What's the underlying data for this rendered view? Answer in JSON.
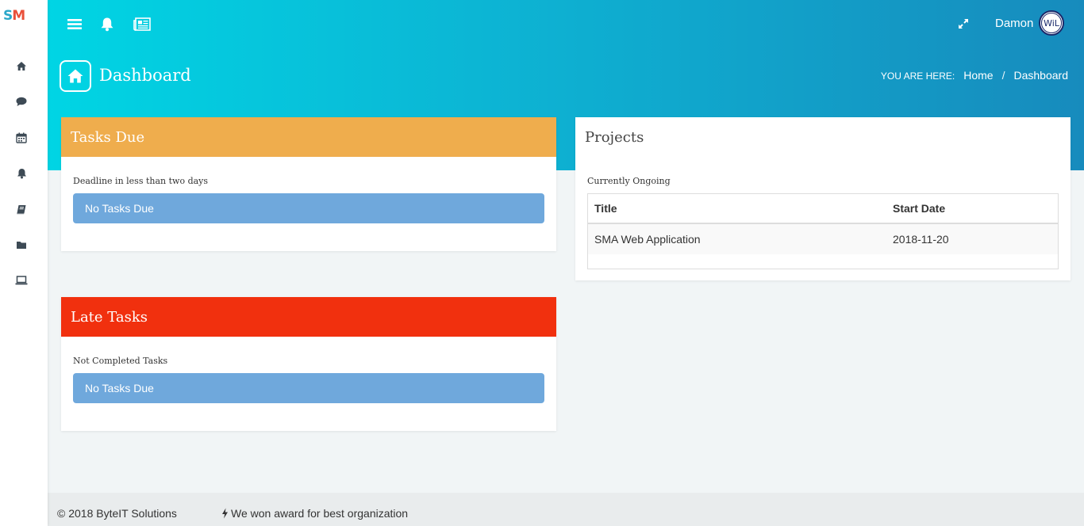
{
  "logo": {
    "s": "S",
    "m": "M"
  },
  "sidebar": {
    "items": [
      {
        "icon": "home-icon"
      },
      {
        "icon": "chat-icon"
      },
      {
        "icon": "calendar-icon"
      },
      {
        "icon": "bell-icon"
      },
      {
        "icon": "book-icon"
      },
      {
        "icon": "folder-icon"
      },
      {
        "icon": "laptop-icon"
      }
    ]
  },
  "topbar": {
    "icons": [
      "menu-icon",
      "bell-icon",
      "newspaper-icon",
      "expand-icon"
    ],
    "username": "Damon",
    "avatar_text": "WiL"
  },
  "page": {
    "title": "Dashboard",
    "breadcrumb": {
      "label": "YOU ARE HERE:",
      "items": [
        "Home",
        "Dashboard"
      ],
      "separator": "/"
    }
  },
  "tasks_due": {
    "title": "Tasks Due",
    "subtitle": "Deadline in less than two days",
    "message": "No Tasks Due",
    "color": "#efad4d"
  },
  "late_tasks": {
    "title": "Late Tasks",
    "subtitle": "Not Completed Tasks",
    "message": "No Tasks Due",
    "color": "#f1300e"
  },
  "projects": {
    "title": "Projects",
    "subtitle": "Currently Ongoing",
    "columns": [
      "Title",
      "Start Date"
    ],
    "rows": [
      {
        "title": "SMA Web Application",
        "start_date": "2018-11-20"
      }
    ]
  },
  "footer": {
    "copyright": "© 2018 ByteIT Solutions",
    "award": "We won award for best organization"
  },
  "colors": {
    "header_start": "#00d5e4",
    "header_end": "#178bbd",
    "message_box": "#6fa8dc"
  }
}
